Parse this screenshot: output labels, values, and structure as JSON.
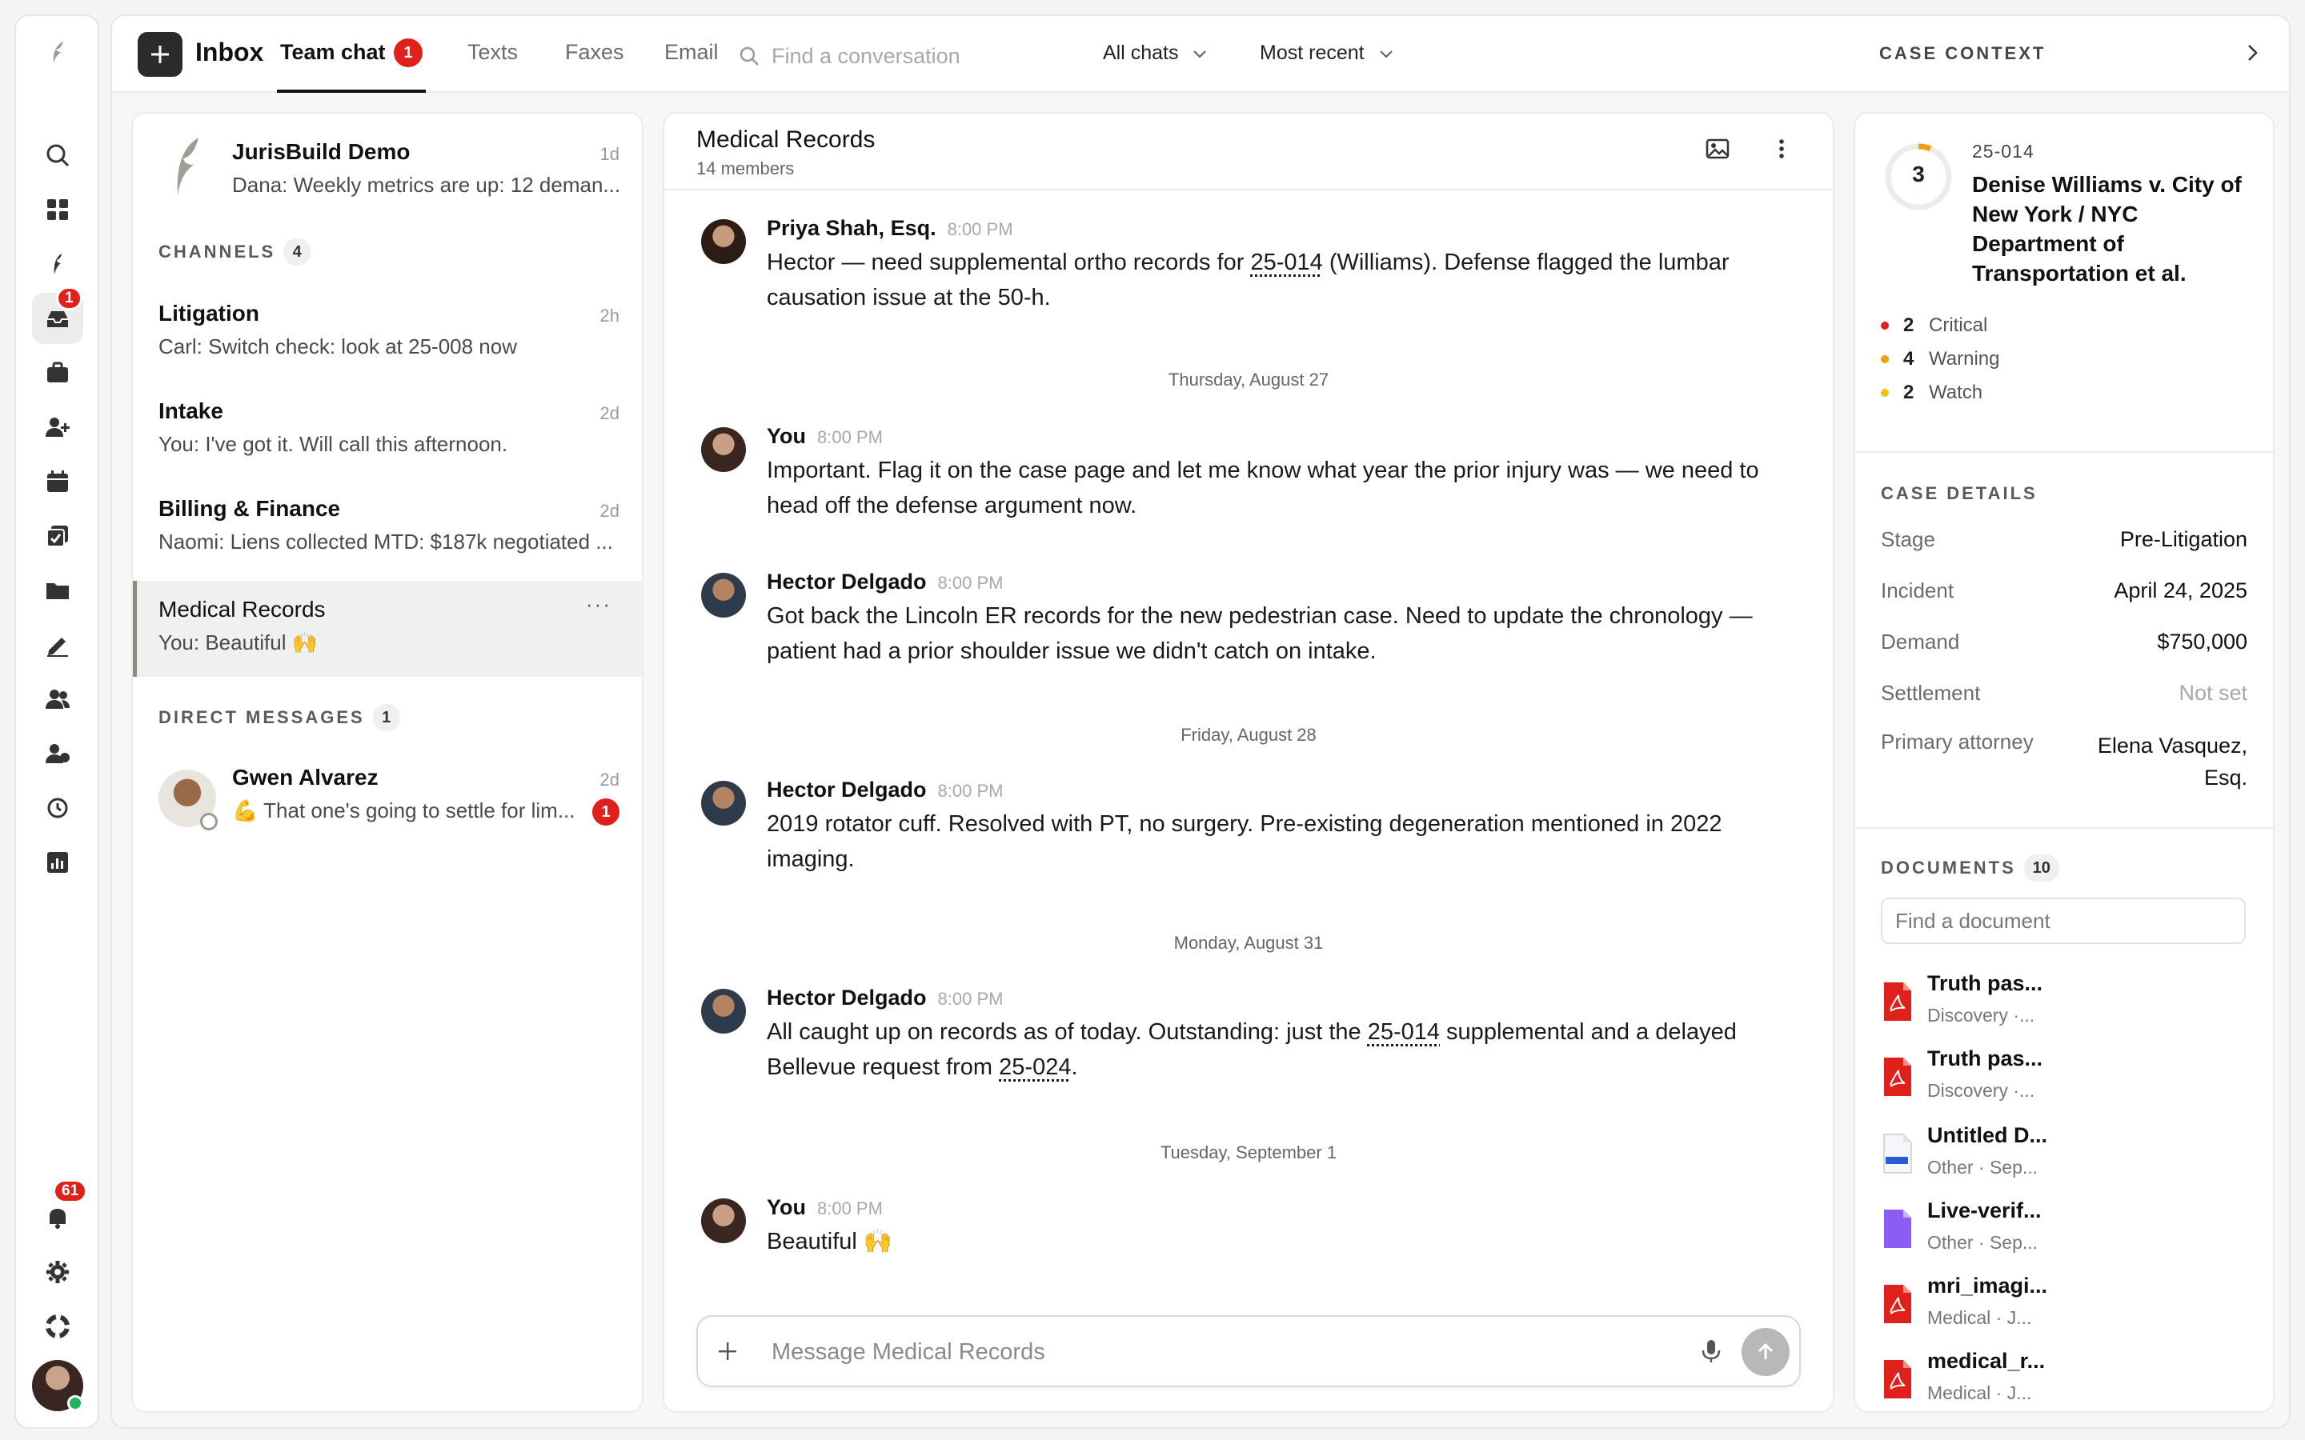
{
  "rail": {
    "notifications_badge": "61",
    "inbox_badge": "1"
  },
  "topbar": {
    "inbox_label": "Inbox",
    "tabs": [
      "Team chat",
      "Texts",
      "Faxes",
      "Email"
    ],
    "team_chat_badge": "1",
    "search_placeholder": "Find a conversation",
    "filter_chats": "All chats",
    "sort": "Most recent",
    "case_context_label": "CASE CONTEXT"
  },
  "conversations": {
    "pinned": {
      "title": "JurisBuild Demo",
      "subtitle": "Dana: Weekly metrics are up: 12 deman...",
      "time": "1d"
    },
    "channels_label": "CHANNELS",
    "channels_count": "4",
    "channels": [
      {
        "title": "Litigation",
        "subtitle": "Carl: Switch check: look at 25-008 now",
        "time": "2h"
      },
      {
        "title": "Intake",
        "subtitle": "You: I've got it. Will call this afternoon.",
        "time": "2d"
      },
      {
        "title": "Billing & Finance",
        "subtitle": "Naomi: Liens collected MTD: $187k negotiated ...",
        "time": "2d"
      },
      {
        "title": "Medical Records",
        "subtitle": "You: Beautiful 🙌",
        "time": "···"
      }
    ],
    "dm_label": "DIRECT MESSAGES",
    "dm_count": "1",
    "dms": [
      {
        "title": "Gwen Alvarez",
        "subtitle": "💪 That one's going to settle for lim...",
        "time": "2d",
        "badge": "1"
      }
    ]
  },
  "chat": {
    "title": "Medical Records",
    "members": "14 members",
    "composer_placeholder": "Message Medical Records",
    "messages": [
      {
        "author": "Priya Shah, Esq.",
        "time": "8:00 PM",
        "line1": "Hector — need supplemental ortho records for ",
        "link1": "25-014",
        "line1b": " (Williams). Defense flagged the lumbar",
        "line2": "causation issue at the 50-h."
      },
      {
        "date": "Thursday, August 27"
      },
      {
        "author": "You",
        "time": "8:00 PM",
        "line1": "Important. Flag it on the case page and let me know what year the prior injury was — we need to",
        "line2": "head off the defense argument now."
      },
      {
        "author": "Hector Delgado",
        "time": "8:00 PM",
        "line1": "Got back the Lincoln ER records for the new pedestrian case. Need to update the chronology —",
        "line2": "patient had a prior shoulder issue we didn't catch on intake."
      },
      {
        "date": "Friday, August 28"
      },
      {
        "author": "Hector Delgado",
        "time": "8:00 PM",
        "line1": "2019 rotator cuff. Resolved with PT, no surgery. Pre-existing degeneration mentioned in 2022",
        "line2": "imaging."
      },
      {
        "date": "Monday, August 31"
      },
      {
        "author": "Hector Delgado",
        "time": "8:00 PM",
        "line1": "All caught up on records as of today. Outstanding: just the ",
        "link1": "25-014",
        "line1b": " supplemental and a delayed",
        "line2": "Bellevue request from ",
        "link2": "25-024",
        "line2b": "."
      },
      {
        "date": "Tuesday, September 1"
      },
      {
        "author": "You",
        "time": "8:00 PM",
        "line1": "Beautiful 🙌"
      }
    ]
  },
  "case": {
    "ring_number": "3",
    "case_number": "25-014",
    "case_title_lines": [
      "Denise Williams v. City of",
      "New York / NYC",
      "Department of",
      "Transportation et al."
    ],
    "alerts": [
      {
        "count": "2",
        "label": "Critical",
        "color": "#e0201b"
      },
      {
        "count": "4",
        "label": "Warning",
        "color": "#f39c12"
      },
      {
        "count": "2",
        "label": "Watch",
        "color": "#f4c20d"
      }
    ],
    "details_label": "CASE DETAILS",
    "details": [
      {
        "label": "Stage",
        "value": "Pre-Litigation"
      },
      {
        "label": "Incident",
        "value": "April 24, 2025"
      },
      {
        "label": "Demand",
        "value": "$750,000"
      },
      {
        "label": "Settlement",
        "value": "Not set"
      },
      {
        "label": "Primary attorney",
        "value": "Elena Vasquez,",
        "value2": "Esq."
      }
    ],
    "documents_label": "DOCUMENTS",
    "documents_count": "10",
    "doc_search_placeholder": "Find a document",
    "documents": [
      {
        "name": "Truth pas...",
        "meta": "Discovery ·...",
        "icon": "pdf"
      },
      {
        "name": "Truth pas...",
        "meta": "Discovery ·...",
        "icon": "pdf"
      },
      {
        "name": "Untitled D...",
        "meta": "Other · Sep...",
        "icon": "docx"
      },
      {
        "name": "Live-verif...",
        "meta": "Other · Sep...",
        "icon": "purple"
      },
      {
        "name": "mri_imagi...",
        "meta": "Medical · J...",
        "icon": "pdf"
      },
      {
        "name": "medical_r...",
        "meta": "Medical · J...",
        "icon": "pdf"
      }
    ]
  },
  "colors": {
    "accent_red": "#e0201b",
    "brand_dark": "#2b2b2b"
  }
}
